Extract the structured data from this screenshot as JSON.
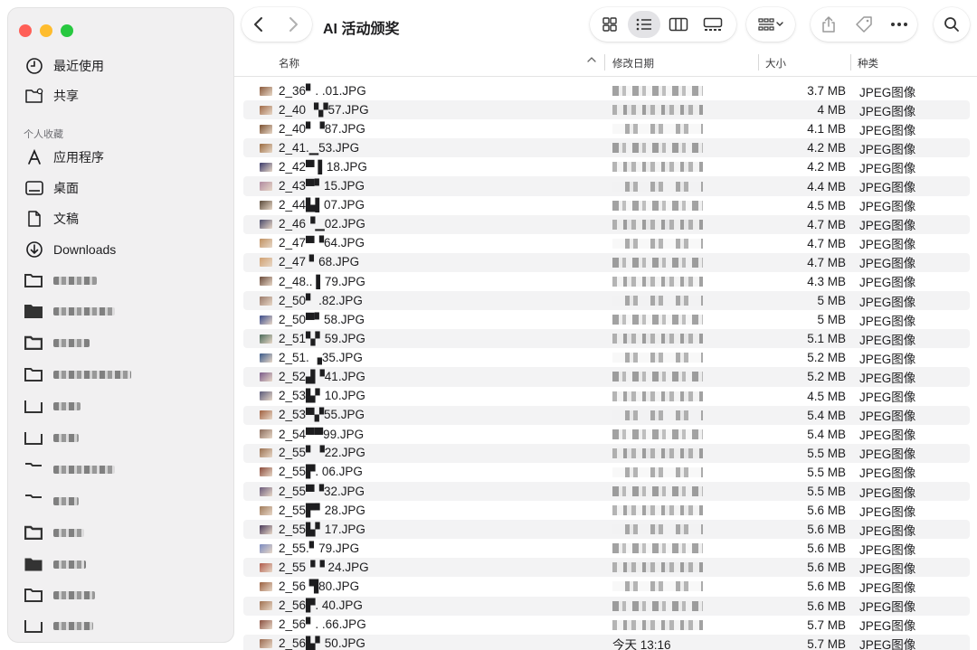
{
  "window": {
    "title": "AI 活动颁奖"
  },
  "sidebar": {
    "top_items": [
      {
        "label": "最近使用",
        "icon": "clock-icon"
      },
      {
        "label": "共享",
        "icon": "shared-folder-icon"
      }
    ],
    "section_label": "个人收藏",
    "favorites": [
      {
        "label": "应用程序",
        "icon": "applications-icon"
      },
      {
        "label": "桌面",
        "icon": "desktop-icon"
      },
      {
        "label": "文稿",
        "icon": "document-icon"
      },
      {
        "label": "Downloads",
        "icon": "download-icon"
      }
    ]
  },
  "columns": {
    "name": "名称",
    "date": "修改日期",
    "size": "大小",
    "kind": "种类"
  },
  "files": [
    {
      "name": "2_36▘. .01.JPG",
      "size": "3.7 MB",
      "kind": "JPEG图像",
      "date": ""
    },
    {
      "name": "2_40 ▝▞57.JPG",
      "size": "4 MB",
      "kind": "JPEG图像",
      "date": ""
    },
    {
      "name": "2_40▘▝87.JPG",
      "size": "4.1 MB",
      "kind": "JPEG图像",
      "date": ""
    },
    {
      "name": "2_41.▁53.JPG",
      "size": "4.2 MB",
      "kind": "JPEG图像",
      "date": ""
    },
    {
      "name": "2_42▀ ▌18.JPG",
      "size": "4.2 MB",
      "kind": "JPEG图像",
      "date": ""
    },
    {
      "name": "2_43▀▘15.JPG",
      "size": "4.4 MB",
      "kind": "JPEG图像",
      "date": ""
    },
    {
      "name": "2_44▙▌07.JPG",
      "size": "4.5 MB",
      "kind": "JPEG图像",
      "date": ""
    },
    {
      "name": "2_46▝▁02.JPG",
      "size": "4.7 MB",
      "kind": "JPEG图像",
      "date": ""
    },
    {
      "name": "2_47▀▝64.JPG",
      "size": "4.7 MB",
      "kind": "JPEG图像",
      "date": ""
    },
    {
      "name": "2_47 ▘68.JPG",
      "size": "4.7 MB",
      "kind": "JPEG图像",
      "date": ""
    },
    {
      "name": "2_48.. ▌79.JPG",
      "size": "4.3 MB",
      "kind": "JPEG图像",
      "date": ""
    },
    {
      "name": "2_50▘ .82.JPG",
      "size": "5 MB",
      "kind": "JPEG图像",
      "date": ""
    },
    {
      "name": "2_50▀▘58.JPG",
      "size": "5 MB",
      "kind": "JPEG图像",
      "date": ""
    },
    {
      "name": "2_51▚▘59.JPG",
      "size": "5.1 MB",
      "kind": "JPEG图像",
      "date": ""
    },
    {
      "name": "2_51. ▗35.JPG",
      "size": "5.2 MB",
      "kind": "JPEG图像",
      "date": ""
    },
    {
      "name": "2_52▟▝41.JPG",
      "size": "5.2 MB",
      "kind": "JPEG图像",
      "date": ""
    },
    {
      "name": "2_53▙▘10.JPG",
      "size": "4.5 MB",
      "kind": "JPEG图像",
      "date": ""
    },
    {
      "name": "2_53▀▞55.JPG",
      "size": "5.4 MB",
      "kind": "JPEG图像",
      "date": ""
    },
    {
      "name": "2_54▀▀99.JPG",
      "size": "5.4 MB",
      "kind": "JPEG图像",
      "date": ""
    },
    {
      "name": "2_55▘▝22.JPG",
      "size": "5.5 MB",
      "kind": "JPEG图像",
      "date": ""
    },
    {
      "name": "2_55▛. 06.JPG",
      "size": "5.5 MB",
      "kind": "JPEG图像",
      "date": ""
    },
    {
      "name": "2_55▀▝32.JPG",
      "size": "5.5 MB",
      "kind": "JPEG图像",
      "date": ""
    },
    {
      "name": "2_55▛▘28.JPG",
      "size": "5.6 MB",
      "kind": "JPEG图像",
      "date": ""
    },
    {
      "name": "2_55▙▘17.JPG",
      "size": "5.6 MB",
      "kind": "JPEG图像",
      "date": ""
    },
    {
      "name": "2_55.▘79.JPG",
      "size": "5.6 MB",
      "kind": "JPEG图像",
      "date": ""
    },
    {
      "name": "2_55▝▝ 24.JPG",
      "size": "5.6 MB",
      "kind": "JPEG图像",
      "date": ""
    },
    {
      "name": "2_56 ▜80.JPG",
      "size": "5.6 MB",
      "kind": "JPEG图像",
      "date": ""
    },
    {
      "name": "2_56▛. 40.JPG",
      "size": "5.6 MB",
      "kind": "JPEG图像",
      "date": ""
    },
    {
      "name": "2_56▘. .66.JPG",
      "size": "5.7 MB",
      "kind": "JPEG图像",
      "date": ""
    },
    {
      "name": "2_56▙▘50.JPG",
      "size": "5.7 MB",
      "kind": "JPEG图像",
      "date": "今天 13:16"
    }
  ],
  "thumb_colors": [
    "#8a5a3c",
    "#a06a48",
    "#7a5030",
    "#9a6a40",
    "#3a3a6a",
    "#b08aa0",
    "#5a4a3a",
    "#4a4a6a",
    "#c09060",
    "#d0a070",
    "#6a4a3a",
    "#9a7a6a",
    "#3a4a8a",
    "#4a6a5a",
    "#3a5a8a",
    "#7a5a8a",
    "#5a5a7a",
    "#a06040",
    "#8a6a5a",
    "#9a7050",
    "#8a4a3a",
    "#6a5a7a",
    "#a07a5a",
    "#4a3a5a",
    "#7a8ac0",
    "#b05a4a",
    "#9a6040",
    "#a07050",
    "#8a5040",
    "#9a6a50"
  ]
}
